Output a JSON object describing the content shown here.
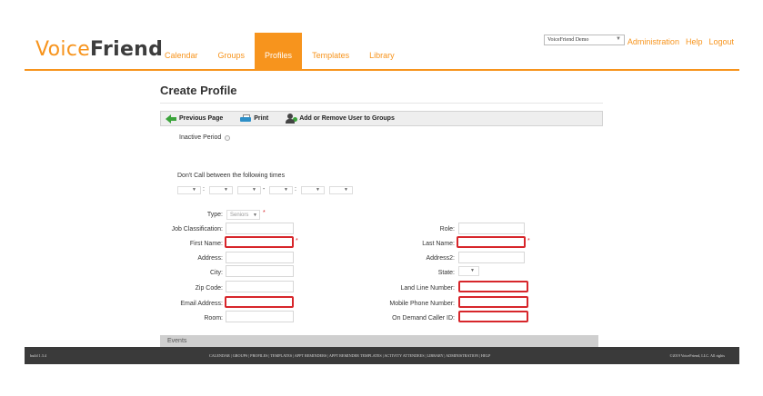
{
  "header": {
    "logo_left": "Voice",
    "logo_right": "Friend",
    "nav": [
      "Calendar",
      "Groups",
      "Profiles",
      "Templates",
      "Library"
    ],
    "active_tab": "Profiles",
    "account_select": "VoiceFriend Demo",
    "top_links": [
      "Administration",
      "Help",
      "Logout"
    ]
  },
  "page": {
    "title": "Create Profile"
  },
  "toolbar": {
    "previous": "Previous Page",
    "print": "Print",
    "add_remove": "Add or Remove User to Groups"
  },
  "form": {
    "inactive_period": "Inactive Period",
    "dont_call": "Don't Call between the following times",
    "type_label": "Type:",
    "type_value": "Seniors",
    "job_classification": "Job Classification:",
    "role": "Role:",
    "first_name": "First Name:",
    "last_name": "Last Name:",
    "address": "Address:",
    "address2": "Address2:",
    "city": "City:",
    "state": "State:",
    "zip": "Zip Code:",
    "land_line": "Land Line Number:",
    "email": "Email Address:",
    "mobile": "Mobile Phone Number:",
    "room": "Room:",
    "on_demand": "On Demand Caller ID:",
    "required_mark": "*",
    "time_sep_colon": ":",
    "time_sep_dash": "-"
  },
  "events": {
    "label": "Events"
  },
  "footer": {
    "build": "build 1.3.4",
    "links": "CALENDAR | GROUPS | PROFILES | TEMPLATES | APPT REMINDERS | APPT REMINDER TEMPLATES | ACTIVITY ATTENDEES | LIBRARY | ADMINISTRATION | HELP",
    "copyright": "©2019 VoiceFriend, LLC. All rights"
  },
  "colors": {
    "accent": "#f7941d",
    "required": "#d7262b",
    "footer_bg": "#3a3a3a"
  }
}
